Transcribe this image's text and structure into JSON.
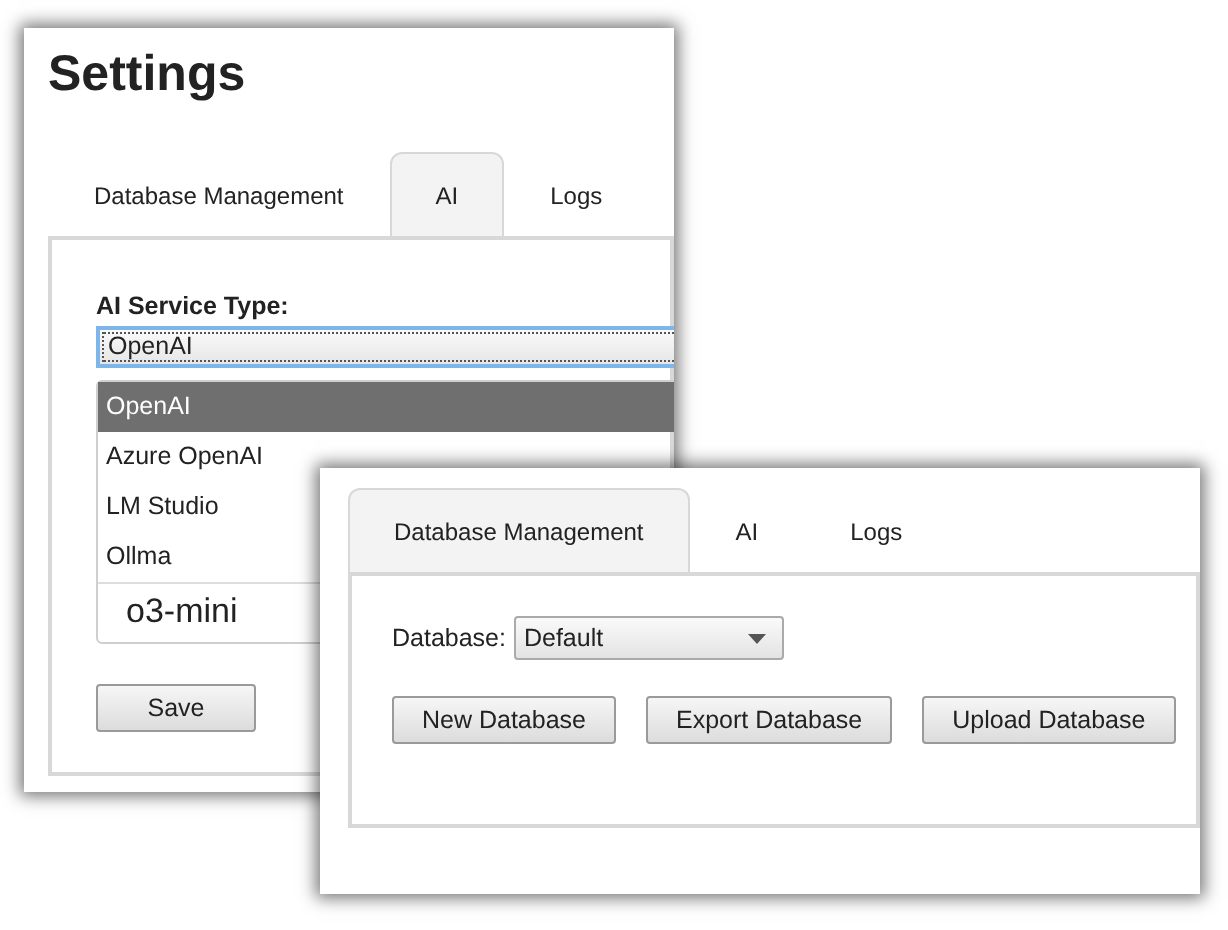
{
  "windows": [
    {
      "title": "Settings",
      "tabs": [
        {
          "label": "Database Management",
          "selected": false
        },
        {
          "label": "AI",
          "selected": true
        },
        {
          "label": "Logs",
          "selected": false
        }
      ],
      "ai_service_type": {
        "label": "AI Service Type:",
        "value": "OpenAI",
        "options": [
          {
            "label": "OpenAI",
            "selected": true
          },
          {
            "label": "Azure OpenAI",
            "selected": false
          },
          {
            "label": "LM Studio",
            "selected": false
          },
          {
            "label": "Ollma",
            "selected": false
          }
        ]
      },
      "model": {
        "value": "o3-mini"
      },
      "buttons": [
        "Save"
      ]
    },
    {
      "tabs": [
        {
          "label": "Database Management",
          "selected": true
        },
        {
          "label": "AI",
          "selected": false
        },
        {
          "label": "Logs",
          "selected": false
        }
      ],
      "database": {
        "label": "Database:",
        "value": "Default"
      },
      "buttons": [
        "New Database",
        "Export Database",
        "Upload Database"
      ]
    }
  ]
}
